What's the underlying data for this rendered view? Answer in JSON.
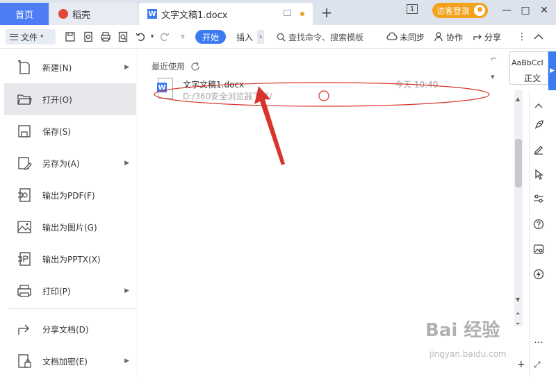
{
  "title_bar": {
    "home_tab": "首页",
    "daoke_tab": "稻壳",
    "doc_tab": "文字文稿1.docx",
    "new_tab": "+",
    "page_number": "1",
    "login": "访客登录",
    "minimize": "—",
    "maximize": "□",
    "close": "✕"
  },
  "toolbar": {
    "file_menu": "文件",
    "start": "开始",
    "insert": "插入",
    "more": "›",
    "search_placeholder": "查找命令、搜索模板",
    "sync": "未同步",
    "collab": "协作",
    "share": "分享"
  },
  "file_menu": {
    "items": [
      {
        "label": "新建(N)",
        "has_submenu": true
      },
      {
        "label": "打开(O)",
        "has_submenu": false,
        "active": true
      },
      {
        "label": "保存(S)",
        "has_submenu": false
      },
      {
        "label": "另存为(A)",
        "has_submenu": true
      },
      {
        "label": "输出为PDF(F)",
        "has_submenu": false
      },
      {
        "label": "输出为图片(G)",
        "has_submenu": false
      },
      {
        "label": "输出为PPTX(X)",
        "has_submenu": false
      },
      {
        "label": "打印(P)",
        "has_submenu": true
      },
      {
        "label": "分享文档(D)",
        "has_submenu": false
      },
      {
        "label": "文档加密(E)",
        "has_submenu": true
      }
    ]
  },
  "recent": {
    "title": "最近使用",
    "file_name": "文字文稿1.docx",
    "file_path": "D:/360安全浏览器下载/",
    "file_time": "今天 10:40"
  },
  "styles": {
    "sample": "AaBbCcI",
    "name": "正文"
  },
  "watermark": {
    "main": "Bai 经验",
    "sub": "jingyan.baidu.com"
  },
  "colors": {
    "accent": "#3a7bf1",
    "login_bg": "#f3a21c",
    "annotation": "#d9342b"
  }
}
